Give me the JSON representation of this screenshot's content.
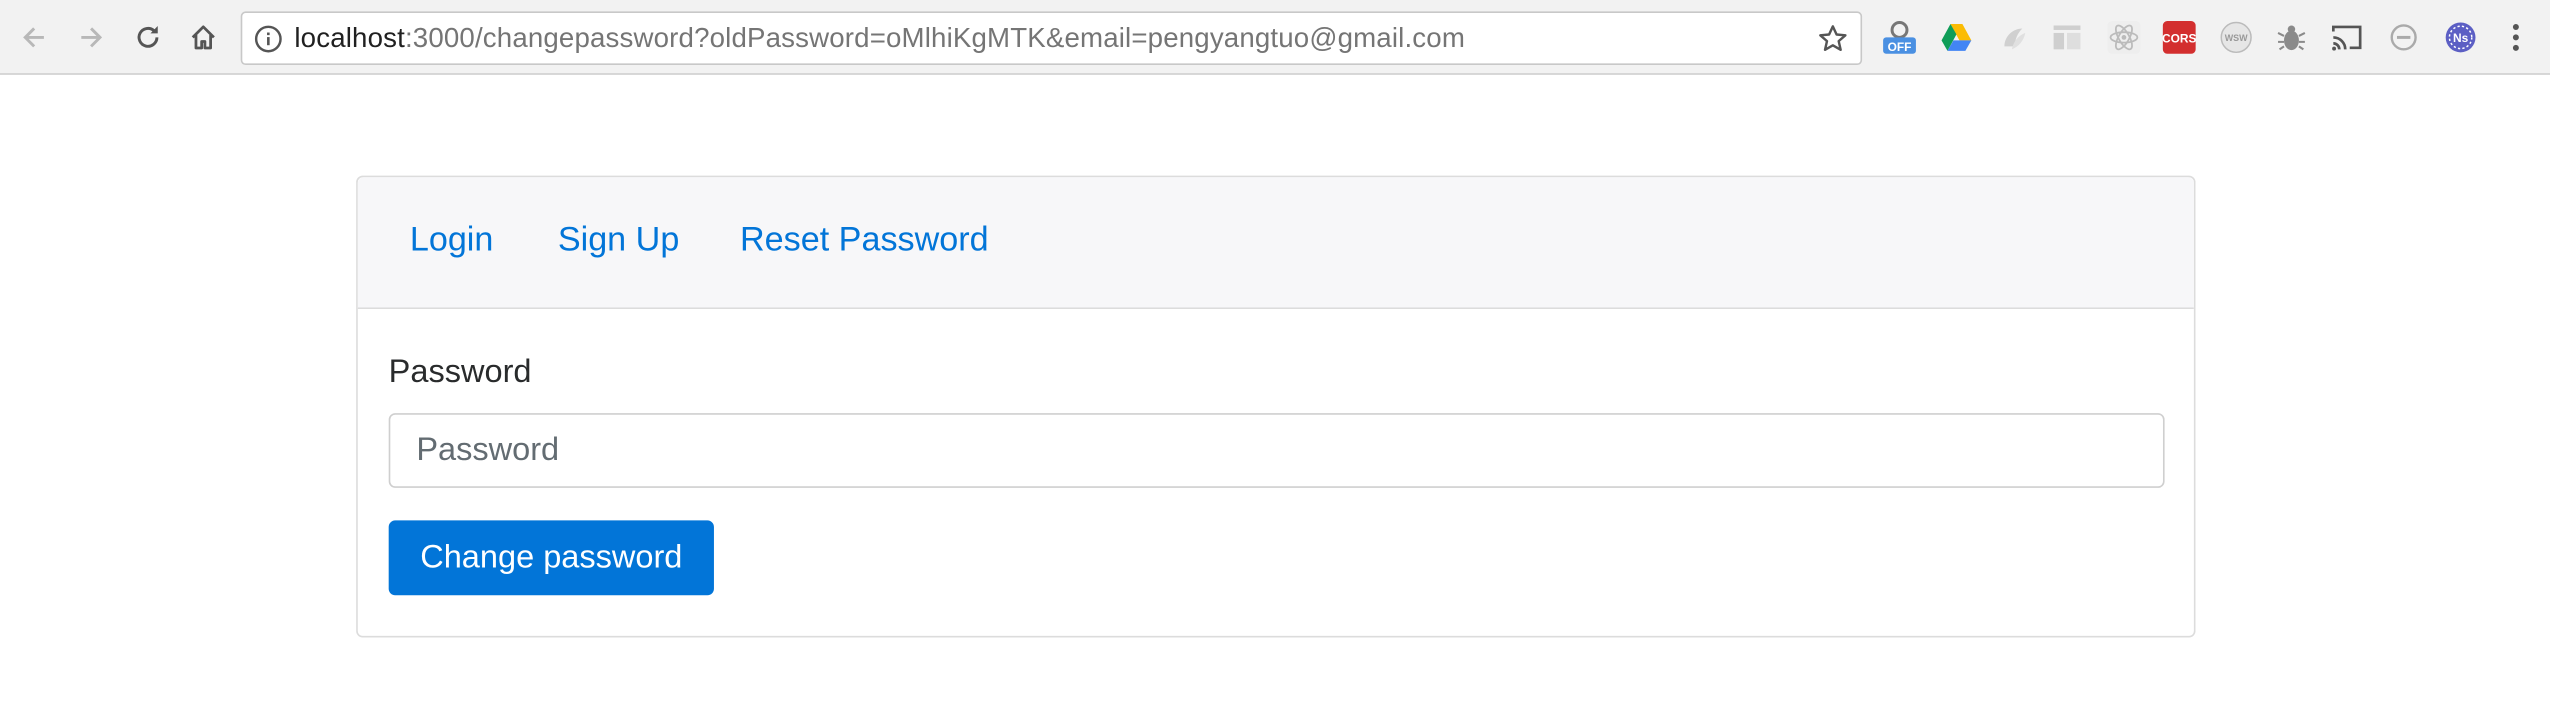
{
  "browser": {
    "url_host": "localhost",
    "url_rest": ":3000/changepassword?oldPassword=oMlhiKgMTK&email=pengyangtuo@gmail.com",
    "nav_icons": [
      "back-arrow-icon",
      "forward-arrow-icon",
      "reload-icon",
      "home-icon"
    ],
    "extension_icons": [
      "off-badge-extension-icon",
      "google-drive-icon",
      "gray-swirl-extension-icon",
      "layout-extension-icon",
      "react-devtools-icon",
      "cors-extension-icon",
      "wsw-extension-icon",
      "bug-extension-icon",
      "cast-icon",
      "blocked-circle-icon",
      "ns-extension-icon",
      "menu-kebab-icon"
    ],
    "ext_badges": {
      "off": "OFF",
      "cors": "CORS",
      "wsw": "WSW",
      "ns": "Ns"
    }
  },
  "nav": {
    "login": "Login",
    "signup": "Sign Up",
    "reset": "Reset Password"
  },
  "form": {
    "password_label": "Password",
    "password_placeholder": "Password",
    "password_value": "",
    "submit_label": "Change password"
  },
  "colors": {
    "link": "#0275d8",
    "primary": "#0275d8",
    "header_bg": "#f7f7f9"
  }
}
